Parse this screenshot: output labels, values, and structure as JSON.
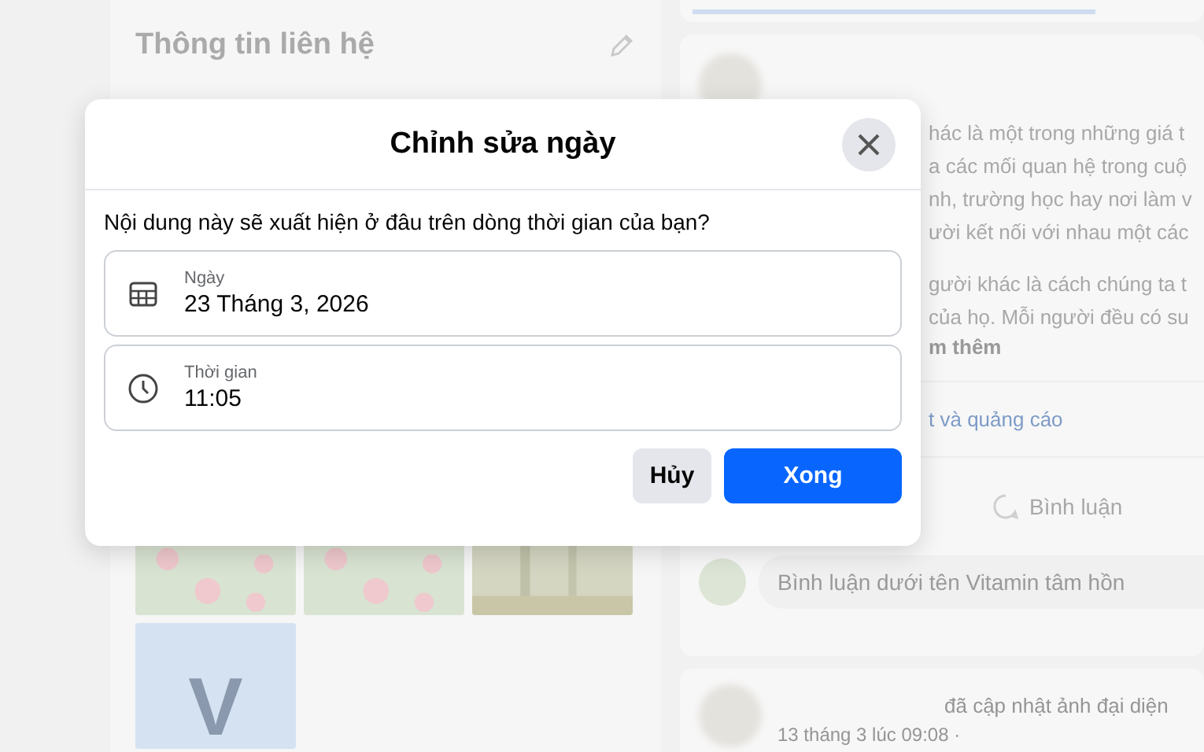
{
  "left_panel": {
    "title": "Thông tin liên hệ",
    "photos": [
      {
        "kind": "roses"
      },
      {
        "kind": "roses"
      },
      {
        "kind": "forest"
      },
      {
        "kind": "letter",
        "letter": "V"
      }
    ]
  },
  "feed": {
    "post": {
      "paragraphs": [
        [
          "hác là một trong những giá t",
          "a các mối quan hệ trong cuộ",
          "nh, trường học hay nơi làm v",
          "ười kết nối với nhau một các"
        ],
        [
          "gười khác là cách chúng ta t",
          "của họ. Mỗi người đều có su"
        ]
      ],
      "see_more": "m thêm",
      "link": "t và quảng cáo",
      "comment_button": "Bình luận",
      "comment_placeholder": "Bình luận dưới tên Vitamin tâm hồn"
    },
    "next_post": {
      "action": "đã cập nhật ảnh đại diện",
      "time": "13 tháng 3 lúc 09:08 ·"
    }
  },
  "dialog": {
    "title": "Chỉnh sửa ngày",
    "question": "Nội dung này sẽ xuất hiện ở đâu trên dòng thời gian của bạn?",
    "fields": [
      {
        "kind": "date",
        "label": "Ngày",
        "value": "23 Tháng 3, 2026"
      },
      {
        "kind": "time",
        "label": "Thời gian",
        "value": "11:05"
      }
    ],
    "buttons": [
      {
        "kind": "secondary",
        "label": "Hủy"
      },
      {
        "kind": "primary",
        "label": "Xong"
      }
    ]
  }
}
